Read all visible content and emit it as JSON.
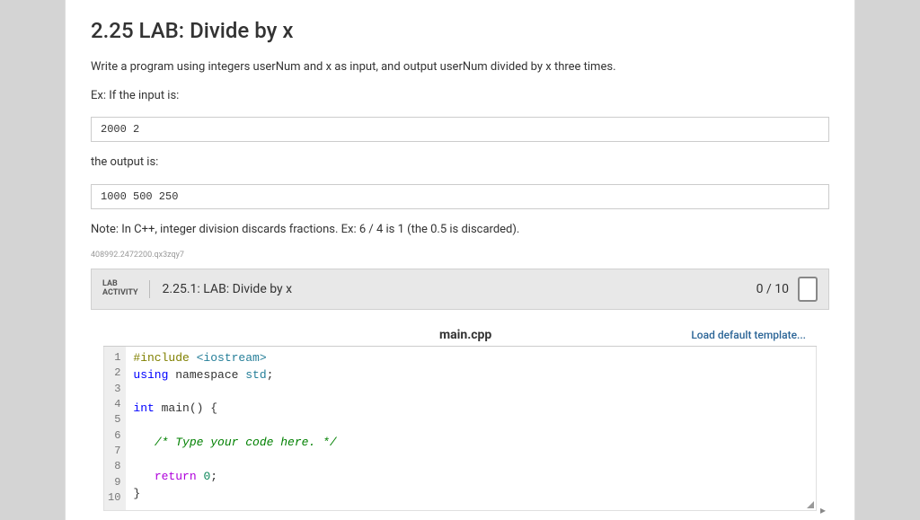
{
  "title": "2.25 LAB: Divide by x",
  "instructions": {
    "intro": "Write a program using integers userNum and x as input, and output userNum divided by x three times.",
    "ex_input_label": "Ex: If the input is:",
    "ex_input": "2000 2",
    "ex_output_label": "the output is:",
    "ex_output": "1000 500 250",
    "note": "Note: In C++, integer division discards fractions. Ex: 6 / 4 is 1 (the 0.5 is discarded).",
    "fine_print": "408992.2472200.qx3zqy7"
  },
  "activity": {
    "label_line1": "LAB",
    "label_line2": "ACTIVITY",
    "title": "2.25.1: LAB: Divide by x",
    "score": "0 / 10"
  },
  "editor": {
    "filename": "main.cpp",
    "load_template": "Load default template...",
    "lines": [
      {
        "n": "1"
      },
      {
        "n": "2"
      },
      {
        "n": "3"
      },
      {
        "n": "4"
      },
      {
        "n": "5"
      },
      {
        "n": "6"
      },
      {
        "n": "7"
      },
      {
        "n": "8"
      },
      {
        "n": "9"
      },
      {
        "n": "10"
      }
    ],
    "code": {
      "l1_include": "#include",
      "l1_header": " <iostream>",
      "l2_using": "using",
      "l2_ns": " namespace ",
      "l2_std": "std",
      "l2_semi": ";",
      "l4_int": "int",
      "l4_main": " main() {",
      "l6_indent": "   ",
      "l6_comment": "/* Type your code here. */",
      "l8_indent": "   ",
      "l8_return": "return",
      "l8_sp": " ",
      "l8_zero": "0",
      "l8_semi": ";",
      "l9_close": "}"
    }
  }
}
